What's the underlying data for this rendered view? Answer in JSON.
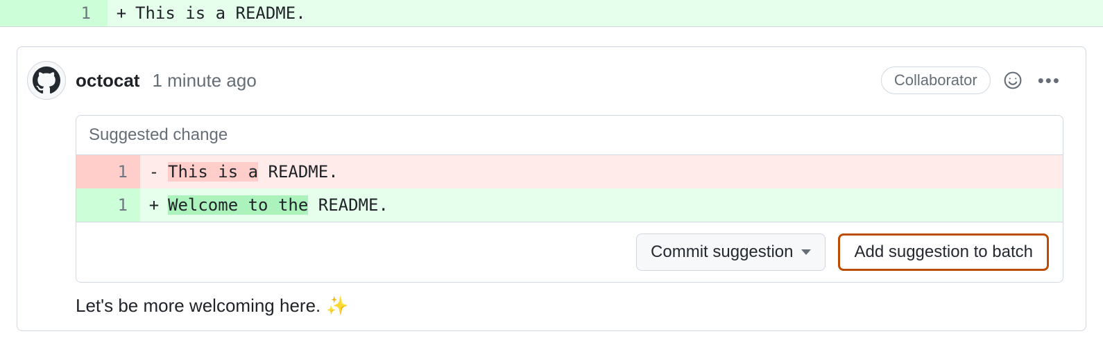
{
  "top_diff": {
    "line_number": "1",
    "sign": "+",
    "code": "This is a README."
  },
  "comment": {
    "author": "octocat",
    "timestamp": "1 minute ago",
    "badge": "Collaborator",
    "body": "Let's be more welcoming here.",
    "emoji": "✨"
  },
  "suggestion": {
    "title": "Suggested change",
    "deletion": {
      "line": "1",
      "sign": "-",
      "highlight": "This is a",
      "rest": " README."
    },
    "addition": {
      "line": "1",
      "sign": "+",
      "highlight": "Welcome to the",
      "rest": " README."
    },
    "commit_label": "Commit suggestion",
    "add_batch_label": "Add suggestion to batch"
  },
  "icons": {
    "emoji_picker": "emoji",
    "menu": "•••"
  }
}
